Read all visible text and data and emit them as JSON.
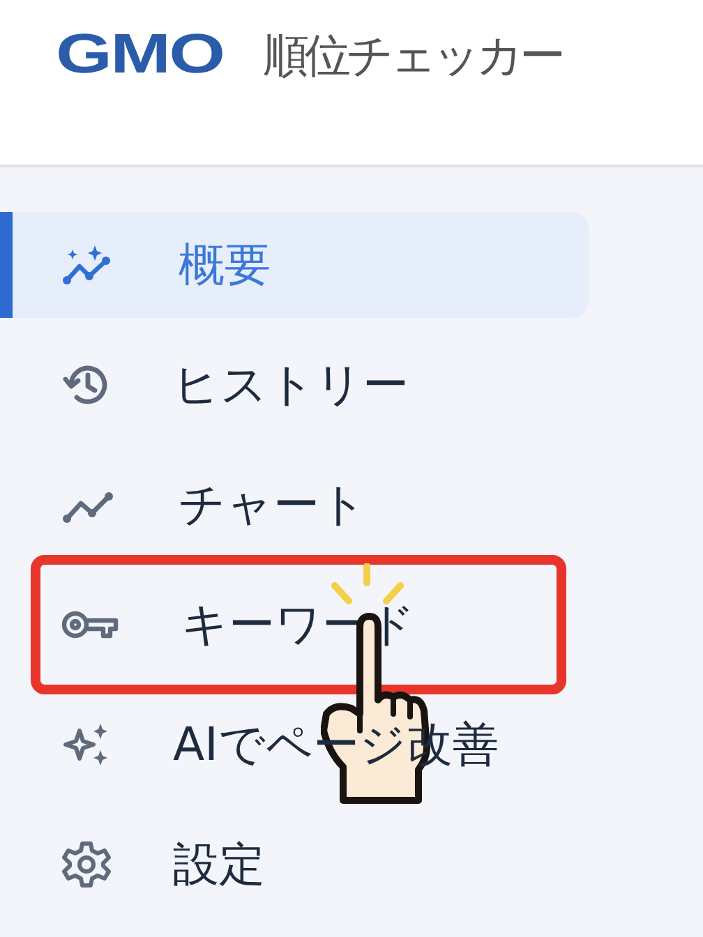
{
  "logo": {
    "mark": "GMO",
    "name": "順位チェッカー"
  },
  "nav": [
    {
      "label": "概要",
      "selected": true,
      "highlighted": false
    },
    {
      "label": "ヒストリー",
      "selected": false,
      "highlighted": false
    },
    {
      "label": "チャート",
      "selected": false,
      "highlighted": false
    },
    {
      "label": "キーワード",
      "selected": false,
      "highlighted": true
    },
    {
      "label": "AIでページ改善",
      "selected": false,
      "highlighted": false
    },
    {
      "label": "設定",
      "selected": false,
      "highlighted": false
    }
  ]
}
